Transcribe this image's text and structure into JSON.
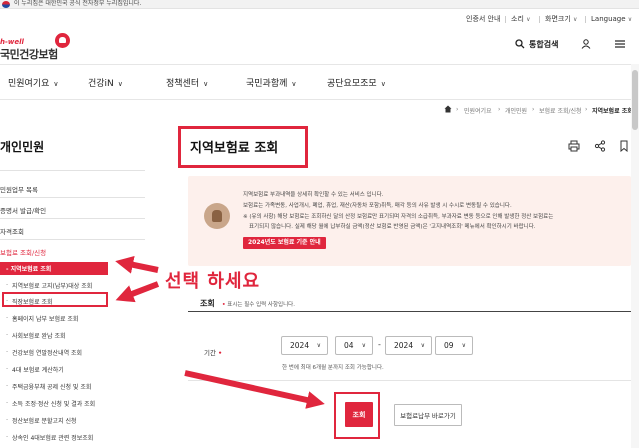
{
  "gov_banner": {
    "text": "이 누리집은 대한민국 공식 전자정부 누리집입니다."
  },
  "utility": {
    "cert": "인증서 안내",
    "sound": "소리",
    "zoom": "화면크기",
    "language": "Language"
  },
  "logo": {
    "tagline": "h-well",
    "name": "국민건강보험"
  },
  "header": {
    "search_label": "통합검색"
  },
  "gnb": {
    "items": [
      {
        "label": "민원여기요"
      },
      {
        "label": "건강iN"
      },
      {
        "label": "정책센터"
      },
      {
        "label": "국민과함께"
      },
      {
        "label": "공단요모조모"
      }
    ]
  },
  "breadcrumb": {
    "items": [
      "민원여기요",
      "개인민원",
      "보험료 조회/신청"
    ],
    "current": "지역보험료 조회"
  },
  "left_nav": {
    "title": "개인민원",
    "items": [
      {
        "label": "민원업무 목록"
      },
      {
        "label": "증명서 발급/확인"
      },
      {
        "label": "자격조회"
      },
      {
        "label": "보험료 조회/신청"
      }
    ],
    "active_sub": "지역보험료 조회",
    "subs": [
      "지역보험료 고지(납부)대상 조회",
      "직장보험료 조회",
      "홈페이지 납부 보험료 조회",
      "사회보험료 완납 조회",
      "건강보험 연말정산내역 조회",
      "4대 보험료 계산하기",
      "주택금융부채 공제 신청 및 조회",
      "소득 조정·정산 신청 및 결과 조회",
      "정산보험료 분할고지 신청",
      "상속인 4대보험료 관련 정보조회"
    ]
  },
  "page": {
    "title": "지역보험료 조회",
    "info_lines": [
      "지역보험료 부과내역을 상세히 확인할 수 있는 서비스 입니다.",
      "보험료는 가족변동, 사업개시, 폐업, 휴업, 재산(자동차 포함)취득, 매각 등의 사유 발생 시 수시로 변동될 수 있습니다.",
      "※ (유의 사항) 해당 보험료는 조회하신 달의 산정 보험료만 표기되며 자격의 소급취득, 부과자료 변동 등으로 인해 발생한 정산 보험료는",
      "표기되지 않습니다. 실제 해당 월에 납부하실 금액(정산 보험료 반영된 금액)은 '고지내역조회' 메뉴에서 확인하시기 바랍니다."
    ],
    "info_button": "2024년도 보험료 기준 안내"
  },
  "form": {
    "section_label": "조회",
    "required_note": "표시는 필수 입력 사항입니다.",
    "period_label": "기간",
    "from_year": "2024",
    "from_month": "04",
    "to_year": "2024",
    "to_month": "09",
    "help": "한 번에 최대 6개월 분까지 조회 가능합니다.",
    "submit": "조회",
    "pay_button": "보험료납부 바로가기"
  },
  "annotation": {
    "text": "선택 하세요"
  },
  "colors": {
    "accent": "#e0263d"
  }
}
